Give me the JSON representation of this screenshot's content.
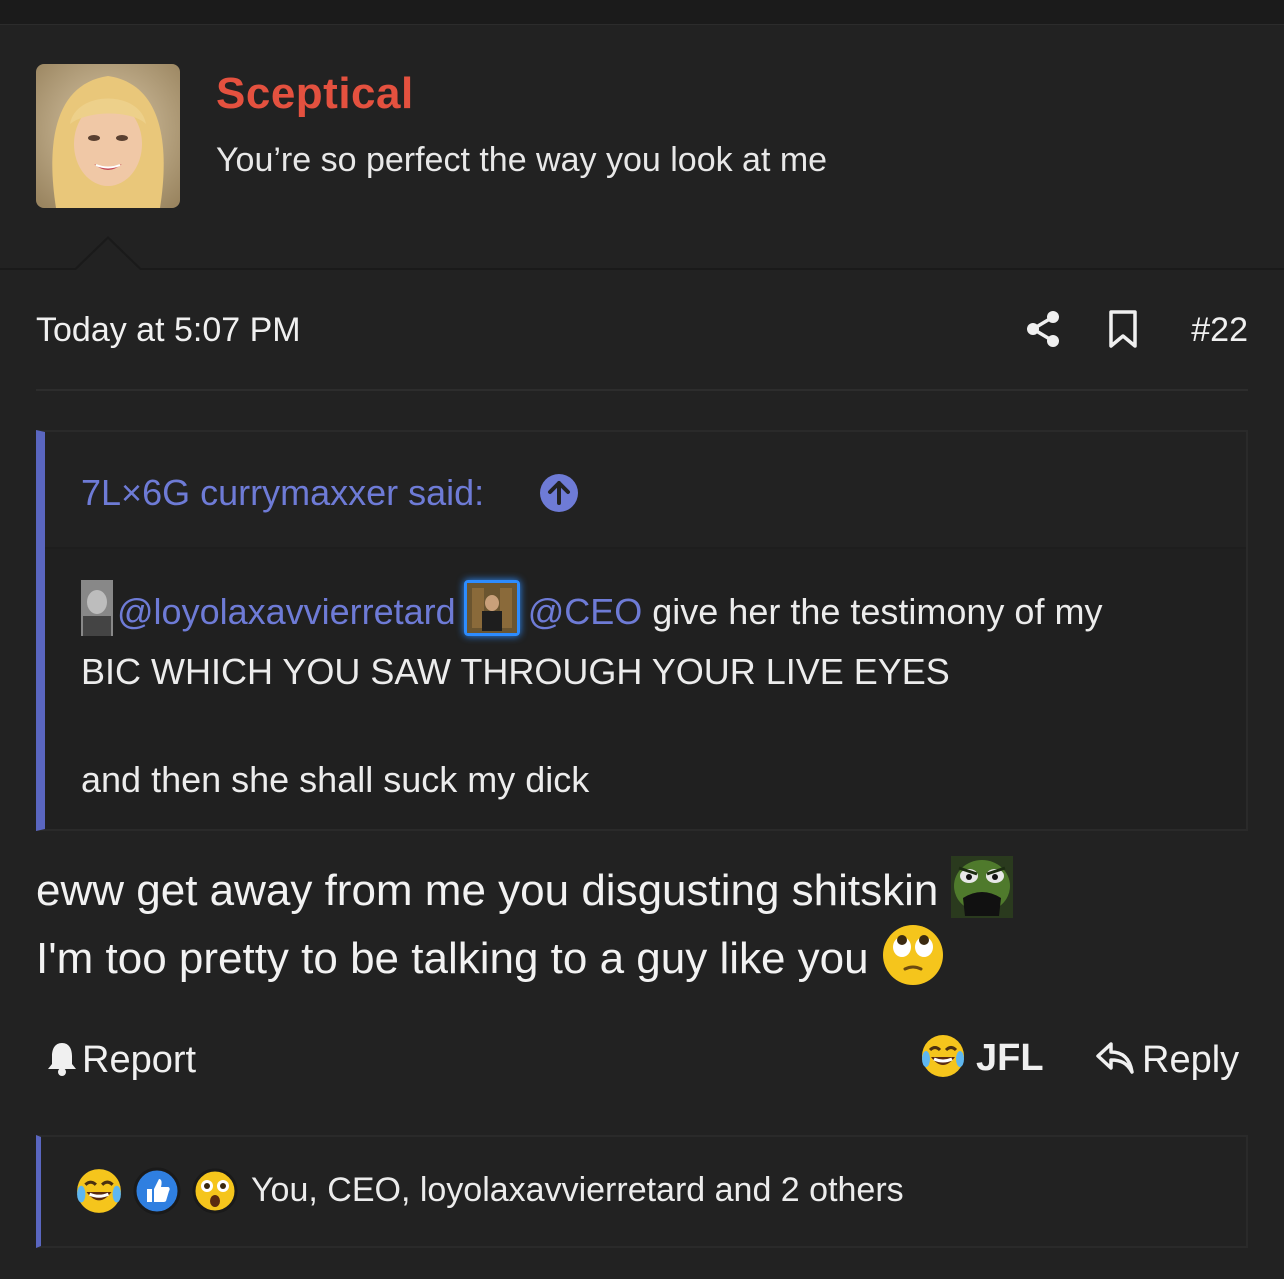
{
  "user": {
    "name": "Sceptical",
    "title": "You’re so perfect the way you look at me"
  },
  "meta": {
    "date": "Today at 5:07 PM",
    "post_number": "#22"
  },
  "quote": {
    "author": "7L×6G currymaxxer said:",
    "mention1": "@loyolaxavvierretard",
    "mention2": "@CEO",
    "line1_rest": " give her the testimony of my",
    "line2": "BIC WHICH YOU SAW THROUGH YOUR LIVE EYES",
    "line3": "and then she shall suck my dick"
  },
  "body": {
    "line1": "eww get away from me you disgusting shitskin",
    "line2": "I'm too pretty to be talking to a guy like you"
  },
  "actions": {
    "report": "Report",
    "react": "JFL",
    "reply": "Reply"
  },
  "reactions": {
    "icons": [
      "crying-laughing-emoji",
      "thumbs-up-icon",
      "shocked-emoji"
    ],
    "summary": "You, CEO, loyolaxavvierretard and 2 others"
  },
  "colors": {
    "username": "#e4513f",
    "link": "#6e7bd6",
    "quote_border": "#5a66c0",
    "background": "#222222"
  }
}
